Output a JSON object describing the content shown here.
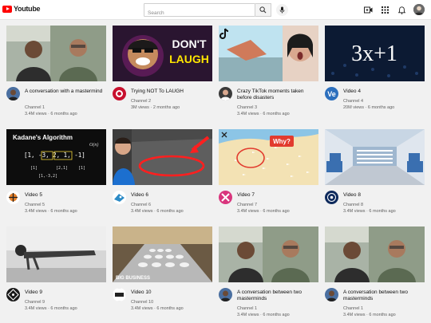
{
  "app": {
    "logo_text": "Youtube"
  },
  "search": {
    "placeholder": "Search"
  },
  "colors": {
    "brand": "#ff0000",
    "background": "#f1f1f1",
    "meta_text": "#606060"
  },
  "header_icons": [
    "create-video-icon",
    "apps-grid-icon",
    "notifications-bell-icon",
    "account-avatar"
  ],
  "videos": [
    {
      "title": "A conversation with a mastermind",
      "channel": "Channel 1",
      "views": "3.4M views",
      "age": "6 months ago",
      "two_line": true
    },
    {
      "title": "Trying NOT To LAUGH",
      "channel": "Channel 2",
      "views": "3M views",
      "age": "2 months ago",
      "two_line": false
    },
    {
      "title": "Crazy TikTok moments taken before disasters",
      "channel": "Channel 3",
      "views": "3.4M views",
      "age": "6 months ago",
      "two_line": true
    },
    {
      "title": "Video 4",
      "channel": "Channel 4",
      "views": "20M views",
      "age": "6 months ago",
      "two_line": false
    },
    {
      "title": "Video 5",
      "channel": "Channel 5",
      "views": "3.4M views",
      "age": "6 months ago",
      "two_line": false
    },
    {
      "title": "Video 6",
      "channel": "Channel 6",
      "views": "3.4M views",
      "age": "6 months ago",
      "two_line": false
    },
    {
      "title": "Video 7",
      "channel": "Channel 7",
      "views": "3.4M views",
      "age": "6 months ago",
      "two_line": false
    },
    {
      "title": "Video 8",
      "channel": "Channel 8",
      "views": "3.4M views",
      "age": "6 months ago",
      "two_line": false
    },
    {
      "title": "Video 9",
      "channel": "Channel 9",
      "views": "3.4M views",
      "age": "6 months ago",
      "two_line": false
    },
    {
      "title": "Video 10",
      "channel": "Channel 10",
      "views": "3.4M views",
      "age": "6 months ago",
      "two_line": false
    },
    {
      "title": "A conversation between two masterminds",
      "channel": "Channel 1",
      "views": "3.4M views",
      "age": "6 months ago",
      "two_line": true
    },
    {
      "title": "A conversation between two masterminds",
      "channel": "Channel 1",
      "views": "3.4M views",
      "age": "6 months ago",
      "two_line": true
    }
  ],
  "thumbnail_text": {
    "laugh_line1": "DON'T",
    "laugh_line2": "LAUGH",
    "math": "3x+1",
    "kadane_title": "Kadane's Algorithm",
    "kadane_array": "[1, -3, 2, 1, -1]",
    "why": "Why?",
    "big_business": "BIG BUSINESS"
  }
}
